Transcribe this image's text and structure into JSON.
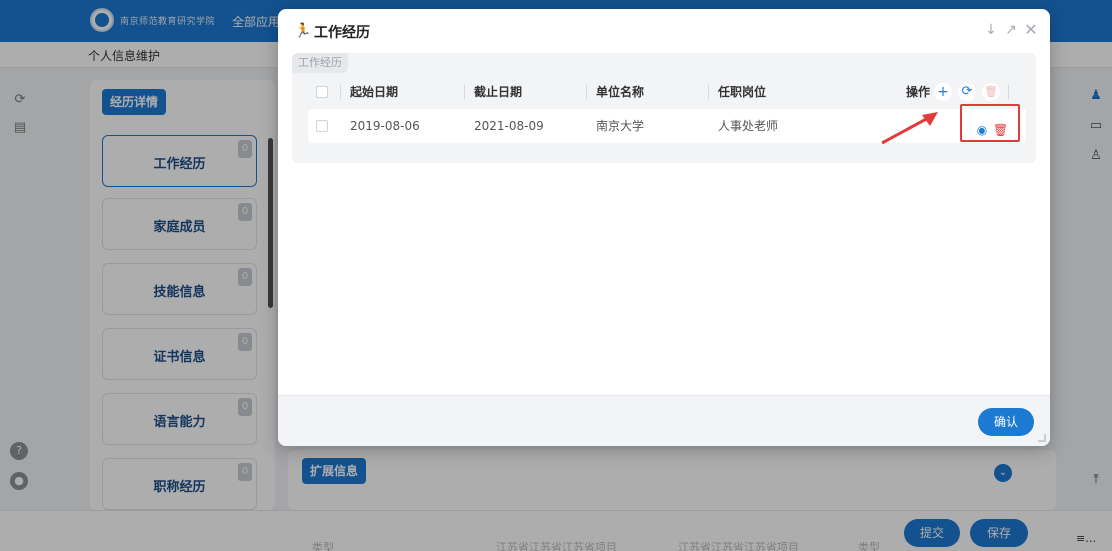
{
  "app": {
    "logo_text": "南京师范教育研究学院",
    "nav_all": "全部应用",
    "page_title": "个人信息维护"
  },
  "side": {
    "header_button": "经历详情",
    "items": [
      {
        "label": "工作经历",
        "count": "0",
        "active": true
      },
      {
        "label": "家庭成员",
        "count": "0"
      },
      {
        "label": "技能信息",
        "count": "0"
      },
      {
        "label": "证书信息",
        "count": "0"
      },
      {
        "label": "语言能力",
        "count": "0"
      },
      {
        "label": "职称经历",
        "count": "0"
      }
    ]
  },
  "extension": {
    "button": "扩展信息"
  },
  "footer": {
    "submit": "提交",
    "save": "保存",
    "ghost": [
      "类型",
      "江苏省江苏省江苏省项目",
      "江苏省江苏省江苏省项目",
      "类型"
    ],
    "corner": "≡…"
  },
  "modal": {
    "title": "工作经历",
    "section_tag": "工作经历",
    "columns": [
      "起始日期",
      "截止日期",
      "单位名称",
      "任职岗位"
    ],
    "ops_label": "操作",
    "rows": [
      {
        "start": "2019-08-06",
        "end": "2021-08-09",
        "unit": "南京大学",
        "position": "人事处老师"
      }
    ],
    "confirm": "确认"
  },
  "colors": {
    "primary": "#1d7ad3",
    "danger": "#e23b3b"
  }
}
